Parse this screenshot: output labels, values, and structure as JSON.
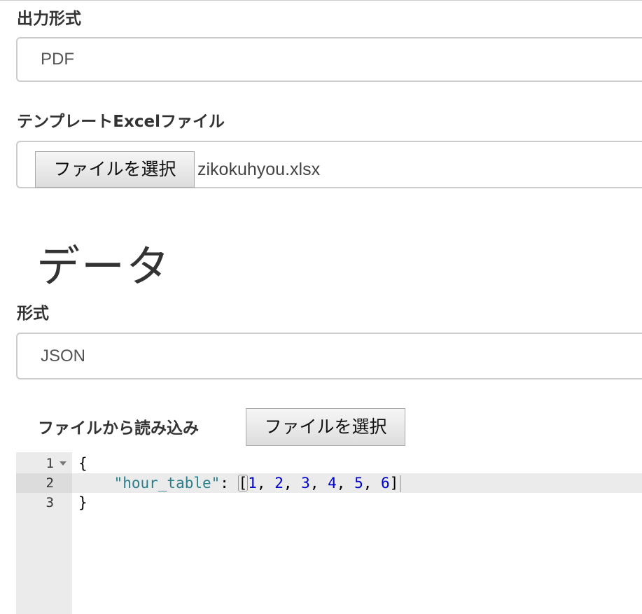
{
  "output": {
    "label": "出力形式",
    "selected": "PDF"
  },
  "template": {
    "label": "テンプレートExcelファイル",
    "button_label": "ファイルを選択",
    "file_name": "zikokuhyou.xlsx"
  },
  "data_section": {
    "heading": "データ",
    "format_label": "形式",
    "format_selected": "JSON",
    "load_label": "ファイルから読み込み",
    "load_button_label": "ファイルを選択"
  },
  "editor": {
    "lines": [
      {
        "number": "1",
        "text": "{"
      },
      {
        "number": "2",
        "key": "\"hour_table\"",
        "sep": ": ",
        "values": [
          "1",
          "2",
          "3",
          "4",
          "5",
          "6"
        ]
      },
      {
        "number": "3",
        "text": "}"
      }
    ],
    "active_line": 2
  }
}
